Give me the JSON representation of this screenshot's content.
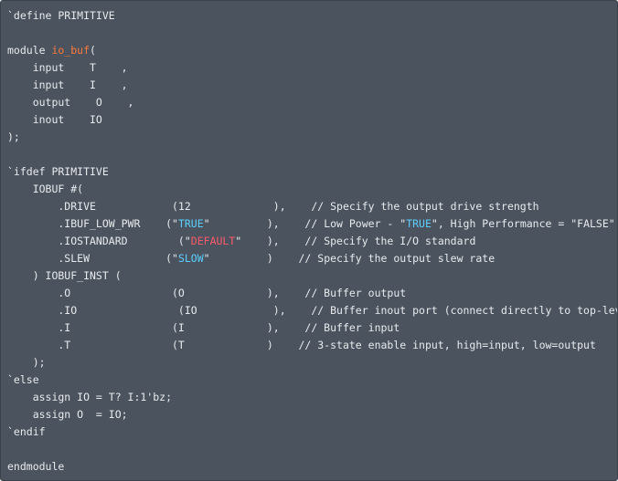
{
  "colors": {
    "background": "#4a535e",
    "text": "#e8ebee",
    "module_name": "#ff7a3c",
    "keyword_value": "#5ccfff",
    "string_value": "#ff5a6b"
  },
  "code_lines": [
    [
      {
        "t": "`define PRIMITIVE"
      }
    ],
    [],
    [
      {
        "t": "module "
      },
      {
        "t": "io_buf",
        "c": "name"
      },
      {
        "t": "("
      }
    ],
    [
      {
        "t": "    input    T    ,"
      }
    ],
    [
      {
        "t": "    input    I    ,"
      }
    ],
    [
      {
        "t": "    output    O    ,"
      }
    ],
    [
      {
        "t": "    inout    IO"
      }
    ],
    [
      {
        "t": ");"
      }
    ],
    [],
    [
      {
        "t": "`ifdef PRIMITIVE"
      }
    ],
    [
      {
        "t": "    IOBUF #("
      }
    ],
    [
      {
        "t": "        .DRIVE            (12             ),    // Specify the output drive strength"
      }
    ],
    [
      {
        "t": "        .IBUF_LOW_PWR    (\""
      },
      {
        "t": "TRUE",
        "c": "true"
      },
      {
        "t": "\"         ),    // Low Power - \""
      },
      {
        "t": "TRUE",
        "c": "true"
      },
      {
        "t": "\", High Performance = \"FALSE\""
      }
    ],
    [
      {
        "t": "        .IOSTANDARD        (\""
      },
      {
        "t": "DEFAULT",
        "c": "str"
      },
      {
        "t": "\"    ),    // Specify the I/O standard"
      }
    ],
    [
      {
        "t": "        .SLEW            (\""
      },
      {
        "t": "SLOW",
        "c": "true"
      },
      {
        "t": "\"         )    // Specify the output slew rate"
      }
    ],
    [
      {
        "t": "    ) IOBUF_INST ("
      }
    ],
    [
      {
        "t": "        .O                (O             ),    // Buffer output"
      }
    ],
    [
      {
        "t": "        .IO                (IO            ),    // Buffer inout port (connect directly to top-level port)"
      }
    ],
    [
      {
        "t": "        .I                (I             ),    // Buffer input"
      }
    ],
    [
      {
        "t": "        .T                (T             )    // 3-state enable input, high=input, low=output"
      }
    ],
    [
      {
        "t": "    );"
      }
    ],
    [
      {
        "t": "`else"
      }
    ],
    [
      {
        "t": "    assign IO = T? I:1'bz;"
      }
    ],
    [
      {
        "t": "    assign O  = IO;"
      }
    ],
    [
      {
        "t": "`endif"
      }
    ],
    [],
    [
      {
        "t": "endmodule"
      }
    ]
  ]
}
